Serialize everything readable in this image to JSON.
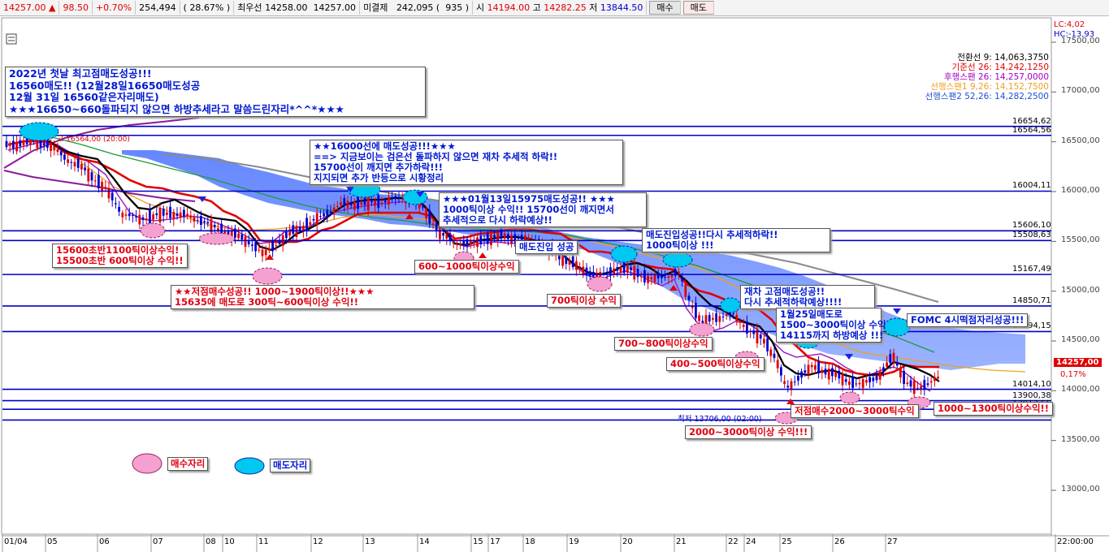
{
  "topbar": {
    "price": "14257.00",
    "change": "98.50",
    "change_pct": "+0.70%",
    "volume": "254,494",
    "volume_pct": "28.67%",
    "best_bid_label": "최우선",
    "best_ask": "14258.00",
    "best_bid": "14257.00",
    "open_int_label": "미결제",
    "open_int": "242,095",
    "open_int_change": "935",
    "open_label": "시",
    "open": "14194.00",
    "high_label": "고",
    "high": "14282.25",
    "low_label": "저",
    "low": "13844.50",
    "buy_button": "매수",
    "sell_button": "매도"
  },
  "chart_data": {
    "type": "candlestick",
    "x_labels": [
      "01/04",
      "05",
      "06",
      "07",
      "08",
      "10",
      "11",
      "12",
      "13",
      "14",
      "15",
      "17",
      "18",
      "19",
      "20",
      "21",
      "22",
      "24",
      "25",
      "26",
      "27",
      "22:00:00"
    ],
    "ylim": [
      12500,
      17650
    ],
    "y_ticks": [
      "17500,00",
      "17000,00",
      "16500,00",
      "16000,00",
      "15500,00",
      "15000,00",
      "14500,00",
      "14000,00",
      "13500,00",
      "13000,00"
    ],
    "current_price": "14257,00",
    "current_pct": "0,17%",
    "lc_label": "LC:4,02",
    "hc_label": "HC:-13,93",
    "legend": [
      {
        "label": "전환선 9: 14,063,3750",
        "color": "#000000"
      },
      {
        "label": "기준선 26: 14,242,1250",
        "color": "#e00000"
      },
      {
        "label": "후행스팬 26: 14,257,0000",
        "color": "#a000c0"
      },
      {
        "label": "선행스팬1 9,26: 14,152,7500",
        "color": "#f0a020"
      },
      {
        "label": "선행스팬2 52,26: 14,282,2500",
        "color": "#2050d0"
      }
    ],
    "hlines": [
      {
        "value": 16654.62,
        "label": "16654,62"
      },
      {
        "value": 16564.56,
        "label": "16564,56"
      },
      {
        "value": 16004.11,
        "label": "16004,11"
      },
      {
        "value": 15606.1,
        "label": "15606,10"
      },
      {
        "value": 15508.63,
        "label": "15508,63"
      },
      {
        "value": 15167.49,
        "label": "15167,49"
      },
      {
        "value": 14850.71,
        "label": "14850,71"
      },
      {
        "value": 14594.15,
        "label": "14594,15"
      },
      {
        "value": 14014.1,
        "label": "14014,10"
      },
      {
        "value": 13900.38,
        "label": "13900,38"
      },
      {
        "value": 13813.56,
        "label": "13813,56"
      },
      {
        "value": 13706.0,
        "label": ""
      }
    ],
    "high_marker": "고 16564,00 (20:00)",
    "low_marker": "최저 13706,00 (02:00)",
    "legend_buy": "매수자리",
    "legend_sell": "매도자리"
  },
  "annotations": [
    {
      "text": "2022년 첫날 최고점매도성공!!!\n16560매도!! (12월28일16650매도성공\n12월 31일 16560같은자리매도)\n★★★16650~660돌파되지 않으면 하방추세라고 말씀드린자리*^^*★★★",
      "color": "blue"
    },
    {
      "text": "★★16000선에 매도성공!!!★★★\n==> 지금보이는 검은선 돌파하지 않으면 재차 추세적 하락!!\n15700선이 깨지면 추가하락!!!\n지지되면 추가 반등으로 시황정리",
      "color": "blue"
    },
    {
      "text": "★★★01월13일15975매도성공!! ★★★\n1000틱이상 수익!! 15700선이 깨지면서\n추세적으로 다시 하락예상!!",
      "color": "blue"
    },
    {
      "text": "15600초반1100틱이상수익!\n15500초반 600틱이상 수익!!",
      "color": "red"
    },
    {
      "text": "★★저점매수성공!! 1000~1900틱이상!!★★★\n15635에 매도로 300틱~600틱이상 수익!!",
      "color": "red"
    },
    {
      "text": "600~1000틱이상수익",
      "color": "red"
    },
    {
      "text": "매도진입 성공",
      "color": "blue"
    },
    {
      "text": "매도진입성공!!다시 추세적하락!!\n1000틱이상 !!!",
      "color": "blue"
    },
    {
      "text": "700틱이상 수익",
      "color": "red"
    },
    {
      "text": "재차 고점매도성공!!\n다시 추세적하락예상!!!!",
      "color": "blue"
    },
    {
      "text": "1월25일매도로\n1500~3000틱이상 수익\n14115까지 하방예상 !!!",
      "color": "blue"
    },
    {
      "text": "FOMC 4시떡점자리성공!!!",
      "color": "blue"
    },
    {
      "text": "700~800틱이상수익",
      "color": "red"
    },
    {
      "text": "400~500틱이상수익",
      "color": "red"
    },
    {
      "text": "저점매수2000~3000틱수익",
      "color": "red"
    },
    {
      "text": "1000~1300틱이상수익!!",
      "color": "red"
    },
    {
      "text": "2000~3000틱이상 수익!!!",
      "color": "red"
    }
  ]
}
